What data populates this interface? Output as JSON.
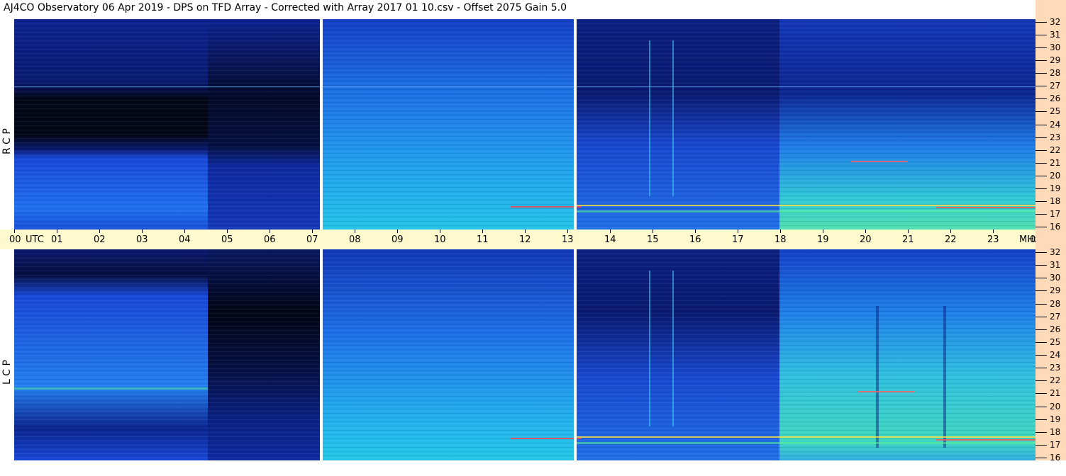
{
  "title": "AJ4CO Observatory  06 Apr 2019  -  DPS on TFD Array  -  Corrected with Array 2017 01 10.csv  -  Offset 2075  Gain 5.0",
  "time_axis": {
    "start_label": "00",
    "unit_label": "UTC",
    "hour_labels": [
      "01",
      "02",
      "03",
      "04",
      "05",
      "06",
      "07",
      "08",
      "09",
      "10",
      "11",
      "12",
      "13",
      "14",
      "15",
      "16",
      "17",
      "18",
      "19",
      "20",
      "21",
      "22",
      "23",
      "00"
    ],
    "freq_unit": "MHz"
  },
  "pol_labels": {
    "top": "R  C  P",
    "bottom": "L  C  P"
  },
  "chart_data": {
    "type": "heatmap",
    "title": "AJ4CO Observatory  06 Apr 2019  -  DPS on TFD Array  -  Corrected with Array 2017 01 10.csv  -  Offset 2075  Gain 5.0",
    "xlabel": "UTC",
    "ylabel": "MHz",
    "x_range_hours": [
      0,
      24
    ],
    "y_range_mhz": [
      16,
      32
    ],
    "y_ticks": [
      32,
      31,
      30,
      29,
      28,
      27,
      26,
      25,
      24,
      23,
      22,
      21,
      20,
      19,
      18,
      17,
      16
    ],
    "panels": [
      "RCP",
      "LCP"
    ],
    "data_gaps_utc": [
      7.2,
      13.1
    ],
    "colormap": [
      "#000820",
      "#0a1e8c",
      "#1a48e0",
      "#2a8ef0",
      "#22d0e0",
      "#80ff80",
      "#ffff00",
      "#ff3030"
    ]
  },
  "colors": {
    "time_axis_bg": "#fffacd",
    "freq_axis_bg": "#ffdab9"
  }
}
